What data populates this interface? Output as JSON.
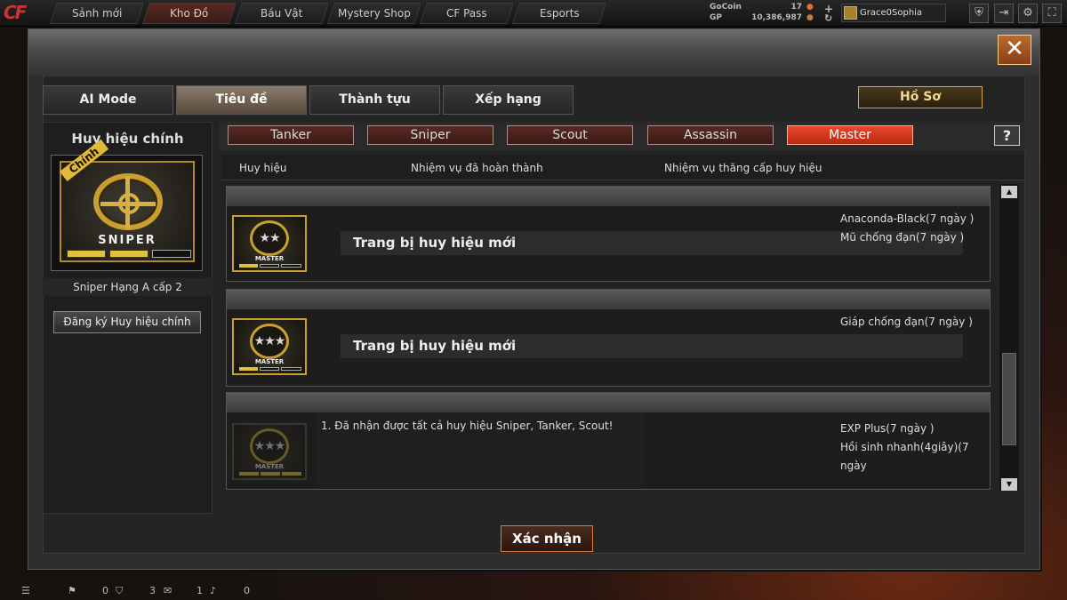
{
  "nav": {
    "items": [
      "Sảnh mới",
      "Kho Đồ",
      "Báu Vật",
      "Mystery Shop",
      "CF Pass",
      "Esports"
    ]
  },
  "currency": {
    "gocoin_label": "GoCoin",
    "gp_label": "GP",
    "gocoin_value": "17",
    "gp_value": "10,386,987"
  },
  "player": {
    "name": "Grace0Sophia"
  },
  "dialog": {
    "close_label": "✕",
    "main_tabs": [
      "AI Mode",
      "Tiêu đề",
      "Thành tựu",
      "Xếp hạng"
    ],
    "profile_button": "Hồ Sơ",
    "confirm_button": "Xác nhận"
  },
  "left": {
    "title": "Huy hiệu chính",
    "badge_tag": "Chính",
    "badge_name": "SNIPER",
    "rank_text": "Sniper Hạng A cấp 2",
    "register_button": "Đăng ký Huy hiệu chính"
  },
  "class_tabs": [
    "Tanker",
    "Sniper",
    "Scout",
    "Assassin",
    "Master"
  ],
  "help_label": "?",
  "columns": [
    "Huy hiệu",
    "Nhiệm vụ đã hoàn thành",
    "Nhiệm vụ thăng cấp huy hiệu"
  ],
  "rows": [
    {
      "medal_label": "MASTER",
      "stars": "★★",
      "mission": "Trang bị huy hiệu mới",
      "rewards": [
        "Anaconda-Black(7 ngày )",
        "Mũ chống đạn(7 ngày )"
      ]
    },
    {
      "medal_label": "MASTER",
      "stars": "★★★",
      "mission": "Trang bị huy hiệu mới",
      "rewards": [
        "Giáp chống đạn(7 ngày )"
      ]
    },
    {
      "medal_label": "MASTER",
      "stars": "★★★",
      "task": "1. Đã nhận được tất cả huy hiệu Sniper, Tanker, Scout!",
      "rewards": [
        "EXP Plus(7 ngày )",
        "Hồi sinh nhanh(4giây)(7 ngày"
      ]
    }
  ],
  "status": {
    "v1": "0",
    "v2": "3",
    "v3": "1",
    "v4": "0"
  }
}
